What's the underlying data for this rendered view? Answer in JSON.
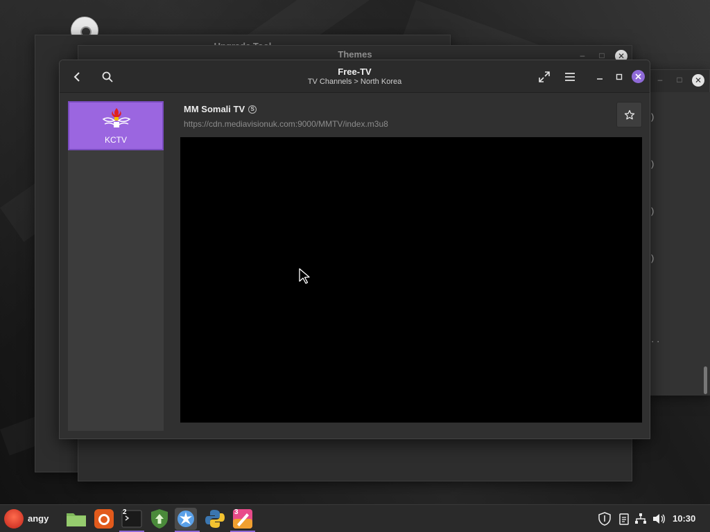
{
  "background_windows": {
    "upgrade_title": "Upgrade Tool",
    "themes_title": "Themes"
  },
  "header": {
    "title": "Free-TV",
    "subtitle": "TV Channels > North Korea"
  },
  "sidebar": {
    "channels": [
      {
        "label": "KCTV"
      }
    ]
  },
  "channel": {
    "name": "MM Somali TV",
    "badge": "S",
    "url": "https://cdn.mediavisionuk.com:9000/MMTV/index.m3u8"
  },
  "taskbar": {
    "user_name": "angy",
    "terminal_badge": "2",
    "paint_badge": "3",
    "clock": "10:30"
  },
  "colors": {
    "accent": "#8f6ad8",
    "tile": "#9b66e0"
  }
}
